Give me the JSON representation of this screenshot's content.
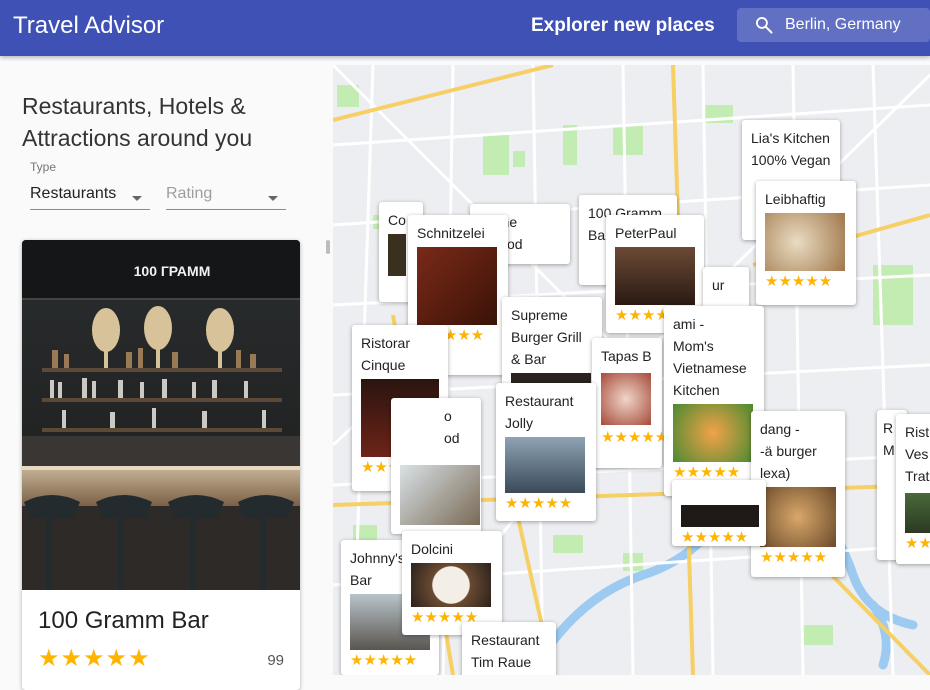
{
  "app": {
    "title": "Travel Advisor",
    "subtitle": "Explorer new places",
    "search_value": "Berlin, Germany"
  },
  "panel": {
    "heading": "Restaurants, Hotels & Attractions around you",
    "type_label": "Type",
    "type_value": "Restaurants",
    "rating_value": "Rating"
  },
  "card": {
    "name": "100 Gramm Bar",
    "stars": "★★★★★",
    "review_count": "99",
    "sign_text": "100 ГРАММ"
  },
  "map_pins": {
    "co": "Co",
    "schnitzelei": "Schnitzelei",
    "fine_food": "k Fine\nn Food",
    "gramm": "100 Gramm\nBar",
    "peterpaul": "PeterPaul",
    "lias": "Lia's Kitchen\n100% Vegan",
    "leibhaftig": "Leibhaftig",
    "ristorante_cinque": "Ristorar\nCinque",
    "supreme": "Supreme\nBurger Grill\n& Bar",
    "tapas": "Tapas B",
    "ur": "ur",
    "vietnamese": "ami -\nMom's\nVietnamese\nKitchen",
    "jolly": "Restaurant\nJolly",
    "rod": "o\nod",
    "dang": "dang -\n-ä burger\nlexa)",
    "risto_right": "Rist\nVes\nTrat",
    "r_right": "R\nM",
    "johnnys": "Johnny's\nBar",
    "dolcini": "Dolcini",
    "tim_raue": "Restaurant\nTim Raue",
    "star_text": "★★★★★"
  },
  "colors": {
    "appbar": "#3f51b5",
    "star": "#ffb400",
    "map_bg": "#eceef1",
    "road_major": "#f6cf65",
    "park": "#c3ecb2",
    "water": "#9ccaf0"
  }
}
